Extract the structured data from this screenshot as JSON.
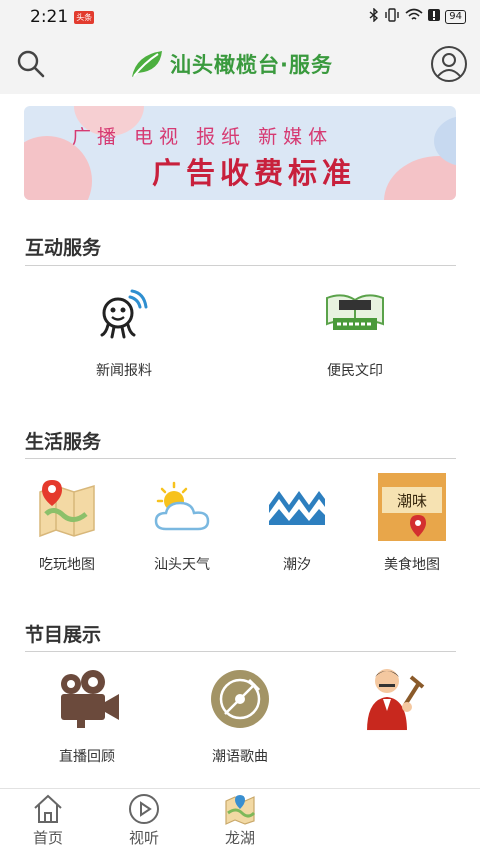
{
  "status_bar": {
    "time": "2:21",
    "badge": "头条",
    "battery": "94",
    "icons": [
      "bluetooth-icon",
      "vibrate-icon",
      "wifi-icon",
      "alert-icon",
      "battery-icon"
    ]
  },
  "header": {
    "title": "汕头橄榄台·服务",
    "accent": "#3a9a3e",
    "left_icon": "search-icon",
    "right_icon": "user-avatar-icon"
  },
  "banner": {
    "line1": "广播 电视 报纸 新媒体",
    "line2": "广告收费标准"
  },
  "sections": [
    {
      "title": "互动服务",
      "items": [
        {
          "label": "新闻报料",
          "icon": "news-tipoff-icon"
        },
        {
          "label": "便民文印",
          "icon": "print-service-icon"
        }
      ]
    },
    {
      "title": "生活服务",
      "items": [
        {
          "label": "吃玩地图",
          "icon": "food-map-icon"
        },
        {
          "label": "汕头天气",
          "icon": "weather-icon"
        },
        {
          "label": "潮汐",
          "icon": "tide-icon"
        },
        {
          "label": "美食地图",
          "icon": "gourmet-map-icon"
        }
      ]
    },
    {
      "title": "节目展示",
      "items": [
        {
          "label": "直播回顾",
          "icon": "video-camera-icon"
        },
        {
          "label": "潮语歌曲",
          "icon": "vinyl-record-icon"
        },
        {
          "label": "",
          "icon": "storyteller-icon"
        }
      ]
    }
  ],
  "bottom_nav": [
    {
      "label": "首页",
      "icon": "home-icon"
    },
    {
      "label": "视听",
      "icon": "play-icon"
    },
    {
      "label": "龙湖",
      "icon": "map-icon"
    }
  ]
}
